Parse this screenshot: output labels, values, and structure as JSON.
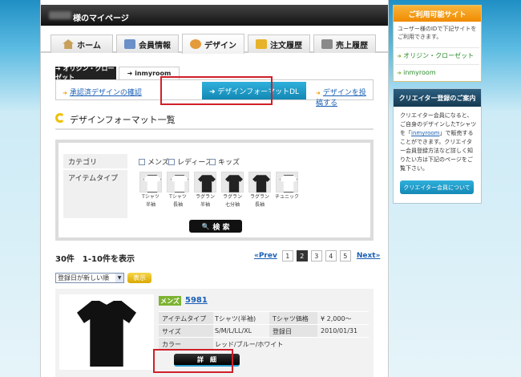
{
  "header": {
    "mypage_title": "様のマイページ"
  },
  "nav": {
    "tabs": [
      {
        "label": "ホーム",
        "icon": "home-icon"
      },
      {
        "label": "会員情報",
        "icon": "member-icon"
      },
      {
        "label": "デザイン",
        "icon": "design-icon"
      },
      {
        "label": "注文履歴",
        "icon": "order-icon"
      },
      {
        "label": "売上履歴",
        "icon": "sales-icon"
      }
    ],
    "active": "デザイン"
  },
  "subtabs": {
    "origin": "➜ オリジン・クローゼット",
    "inmyroom": "➜ inmyroom"
  },
  "submenu": {
    "approved": "承認済デザインの確認",
    "format_dl": "➜ デザインフォーマットDL",
    "post": "デザインを投稿する"
  },
  "section_title": "デザインフォーマット一覧",
  "search": {
    "category_label": "カテゴリ",
    "categories": [
      "メンズ",
      "レディース",
      "キッズ"
    ],
    "item_type_label": "アイテムタイプ",
    "item_types": [
      {
        "line1": "Tシャツ",
        "line2": "半袖"
      },
      {
        "line1": "Tシャツ",
        "line2": "長袖"
      },
      {
        "line1": "ラグラン",
        "line2": "半袖"
      },
      {
        "line1": "ラグラン",
        "line2": "七分袖"
      },
      {
        "line1": "ラグラン",
        "line2": "長袖"
      },
      {
        "line1": "チュニック",
        "line2": ""
      }
    ],
    "button": "検 索"
  },
  "results": {
    "summary": "30件　1-10件を表示",
    "prev": "«Prev",
    "pages": [
      "1",
      "2",
      "3",
      "4",
      "5"
    ],
    "current_page": "2",
    "next": "Next»"
  },
  "sort": {
    "selected": "登録日が新しい順",
    "button": "表示"
  },
  "product": {
    "badge": "メンズ",
    "id": "5981",
    "item_type_label": "アイテムタイプ",
    "item_type": "Tシャツ(半袖)",
    "price_label": "Tシャツ価格",
    "price": "¥ 2,000〜",
    "size_label": "サイズ",
    "size": "S/M/L/LL/XL",
    "date_label": "登録日",
    "date": "2010/01/31",
    "color_label": "カラー",
    "color": "レッド/ブルー/ホワイト",
    "detail_button": "詳　細"
  },
  "sidebar": {
    "available": {
      "title": "ご利用可能サイト",
      "desc": "ユーザー様のIDで下記サイトをご利用できます。",
      "links": [
        "オリジン・クローゼット",
        "inmyroom"
      ]
    },
    "creator": {
      "title": "クリエイター登録のご案内",
      "text1": "クリエイター会員になると、ご自身のデザインしたTシャツを",
      "link": "inmyroom",
      "text2": "で販売することができます。クリエイター会員登録方法など詳しく知りたい方は下記のページをご覧下さい。",
      "button": "クリエイター会員について"
    }
  },
  "colors": {
    "accent": "#1a9ccd",
    "highlight": "#d0202a",
    "mens_badge": "#7db331"
  }
}
